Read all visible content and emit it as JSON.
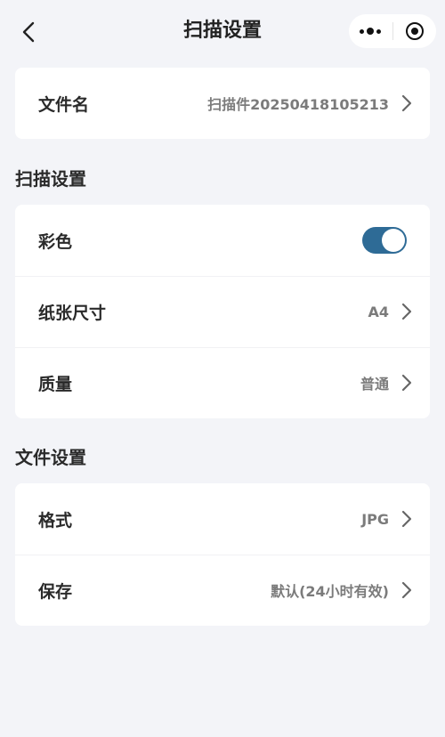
{
  "header": {
    "title": "扫描设置",
    "back_icon": "chevron-left-icon",
    "more_icon": "more-dots-icon",
    "close_icon": "target-circle-icon"
  },
  "file_card": {
    "name_label": "文件名",
    "name_value": "扫描件20250418105213"
  },
  "scan_section": {
    "title": "扫描设置",
    "color_label": "彩色",
    "color_enabled": true,
    "paper_label": "纸张尺寸",
    "paper_value": "A4",
    "quality_label": "质量",
    "quality_value": "普通"
  },
  "file_section": {
    "title": "文件设置",
    "format_label": "格式",
    "format_value": "JPG",
    "save_label": "保存",
    "save_value": "默认(24小时有效)"
  },
  "colors": {
    "accent": "#2e6b96",
    "background": "#f3f4f8",
    "card": "#ffffff"
  }
}
